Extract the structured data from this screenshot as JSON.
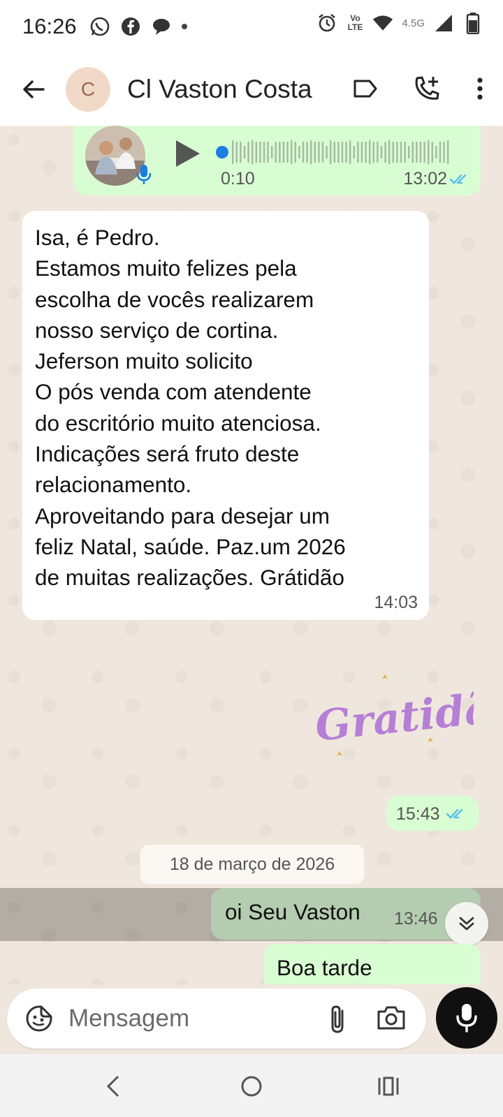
{
  "status_bar": {
    "time": "16:26",
    "network_label": "4.5G",
    "volte_label": "Vo LTE"
  },
  "header": {
    "avatar_initial": "C",
    "contact_name": "Cl Vaston Costa"
  },
  "voice_message": {
    "duration": "0:10",
    "time": "13:02",
    "status": "read"
  },
  "incoming_message": {
    "text": "Isa, é Pedro.\nEstamos muito felizes  pela\nescolha de vocês realizarem\nnosso serviço de cortina.\nJeferson muito solicito\nO pós  venda com atendente\ndo escritório  muito atenciosa.\nIndicações  será fruto deste\nrelacionamento.\nAproveitando  para desejar um\nfeliz Natal, saúde. Paz.um 2026\nde muitas realizações. Grátidão",
    "time": "14:03"
  },
  "sticker": {
    "text": "Gratidão"
  },
  "sticker_time": "15:43",
  "date_divider": "18 de março de 2026",
  "outgoing_selected": {
    "text": "oi Seu Vaston",
    "time": "13:46"
  },
  "outgoing_partial": {
    "text": "Boa tarde"
  },
  "input": {
    "placeholder": "Mensagem"
  },
  "colors": {
    "outgoing_bubble": "#d9fdd3",
    "incoming_bubble": "#ffffff",
    "chat_background": "#efe7dd",
    "read_ticks": "#53bdeb",
    "mic_button": "#101010"
  },
  "icons": [
    "whatsapp-icon",
    "facebook-icon",
    "chat-bubble-icon",
    "alarm-icon",
    "wifi-icon",
    "signal-icon",
    "battery-icon",
    "back-arrow-icon",
    "label-icon",
    "add-call-icon",
    "more-vert-icon",
    "play-icon",
    "mic-icon",
    "double-chevron-down-icon",
    "sticker-icon",
    "attach-icon",
    "camera-icon",
    "nav-back-icon",
    "nav-home-icon",
    "nav-recents-icon"
  ]
}
